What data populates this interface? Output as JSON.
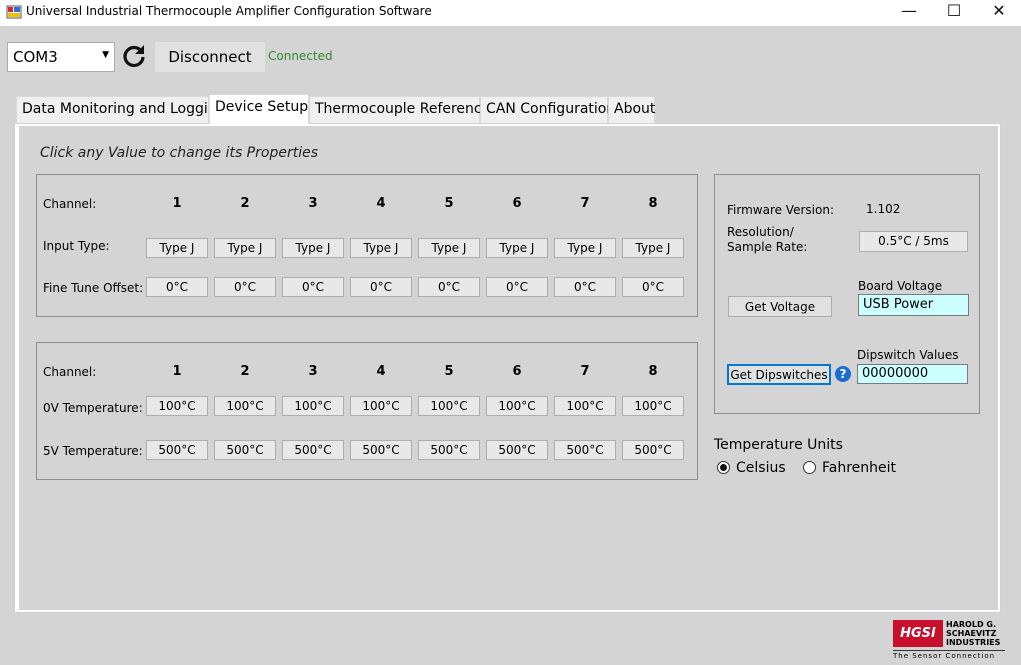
{
  "window": {
    "title": "Universal Industrial Thermocouple Amplifier Configuration Software",
    "controls": {
      "minimize": "—",
      "maximize": "☐",
      "close": "✕"
    }
  },
  "toolbar": {
    "port_value": "COM3",
    "disconnect_label": "Disconnect",
    "status": "Connected"
  },
  "tabs": [
    {
      "label": "Data Monitoring and Logging"
    },
    {
      "label": "Device Setup"
    },
    {
      "label": "Thermocouple Reference"
    },
    {
      "label": "CAN Configuration"
    },
    {
      "label": "About"
    }
  ],
  "device_setup": {
    "instruction": "Click any Value to change its Properties",
    "input_group": {
      "channel_label": "Channel:",
      "input_type_label": "Input Type:",
      "offset_label": "Fine Tune Offset:",
      "channels": [
        "1",
        "2",
        "3",
        "4",
        "5",
        "6",
        "7",
        "8"
      ],
      "input_types": [
        "Type J",
        "Type J",
        "Type J",
        "Type J",
        "Type J",
        "Type J",
        "Type J",
        "Type J"
      ],
      "offsets": [
        "0°C",
        "0°C",
        "0°C",
        "0°C",
        "0°C",
        "0°C",
        "0°C",
        "0°C"
      ]
    },
    "scaling_group": {
      "channel_label": "Channel:",
      "zero_label": "0V Temperature:",
      "five_label": "5V Temperature:",
      "channels": [
        "1",
        "2",
        "3",
        "4",
        "5",
        "6",
        "7",
        "8"
      ],
      "zero_temps": [
        "100°C",
        "100°C",
        "100°C",
        "100°C",
        "100°C",
        "100°C",
        "100°C",
        "100°C"
      ],
      "five_temps": [
        "500°C",
        "500°C",
        "500°C",
        "500°C",
        "500°C",
        "500°C",
        "500°C",
        "500°C"
      ]
    },
    "device_info": {
      "firmware_label": "Firmware Version:",
      "firmware_value": "1.102",
      "resolution_label_1": "Resolution/",
      "resolution_label_2": "Sample Rate:",
      "resolution_value": "0.5°C / 5ms",
      "board_voltage_label": "Board Voltage",
      "get_voltage_label": "Get Voltage",
      "board_voltage_value": "USB Power",
      "dipswitch_label": "Dipswitch Values",
      "get_dipswitches_label": "Get Dipswitches",
      "help_icon": "?",
      "dipswitch_value": "00000000"
    },
    "units": {
      "title": "Temperature Units",
      "options": [
        "Celsius",
        "Fahrenheit"
      ],
      "selected": "Celsius"
    }
  },
  "logo": {
    "mark": "HGSI",
    "name_1": "HAROLD G.",
    "name_2": "SCHAEVITZ",
    "name_3": "INDUSTRIES",
    "tagline": "The Sensor Connection",
    "color": "#c8102e"
  }
}
